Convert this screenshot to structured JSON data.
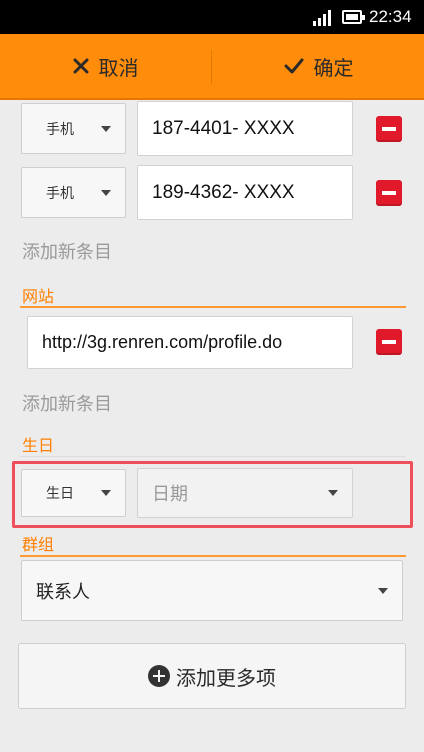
{
  "status_bar": {
    "time": "22:34"
  },
  "action_bar": {
    "cancel_label": "取消",
    "ok_label": "确定"
  },
  "phones": [
    {
      "type": "手机",
      "number": "187-4401- XXXX"
    },
    {
      "type": "手机",
      "number": "189-4362- XXXX"
    }
  ],
  "add_entry_label": "添加新条目",
  "website": {
    "title": "网站",
    "value": "http://3g.renren.com/profile.do",
    "add_entry_label": "添加新条目"
  },
  "birthday": {
    "title": "生日",
    "type": "生日",
    "placeholder": "日期"
  },
  "group": {
    "title": "群组",
    "value": "联系人"
  },
  "add_more_label": "添加更多项",
  "colors": {
    "accent": "#ff8c0a",
    "remove": "#e01a2b",
    "highlight": "#ef4f5b"
  }
}
